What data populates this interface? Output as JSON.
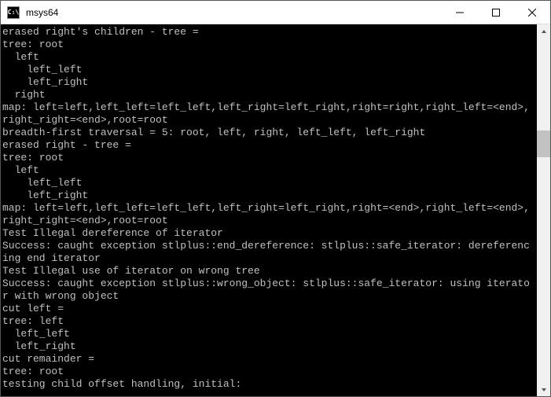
{
  "window": {
    "title": "msys64",
    "icon_label": "C:\\"
  },
  "controls": {
    "minimize": "Minimize",
    "maximize": "Maximize",
    "close": "Close"
  },
  "console": {
    "lines": [
      "erased right's children - tree =",
      "tree: root",
      "  left",
      "    left_left",
      "    left_right",
      "  right",
      "map: left=left,left_left=left_left,left_right=left_right,right=right,right_left=<end>,right_right=<end>,root=root",
      "breadth-first traversal = 5: root, left, right, left_left, left_right",
      "erased right - tree =",
      "tree: root",
      "  left",
      "    left_left",
      "    left_right",
      "map: left=left,left_left=left_left,left_right=left_right,right=<end>,right_left=<end>,right_right=<end>,root=root",
      "Test Illegal dereference of iterator",
      "Success: caught exception stlplus::end_dereference: stlplus::safe_iterator: dereferencing end iterator",
      "Test Illegal use of iterator on wrong tree",
      "Success: caught exception stlplus::wrong_object: stlplus::safe_iterator: using iterator with wrong object",
      "cut left =",
      "tree: left",
      "  left_left",
      "  left_right",
      "cut remainder =",
      "tree: root",
      "testing child offset handling, initial:"
    ]
  }
}
